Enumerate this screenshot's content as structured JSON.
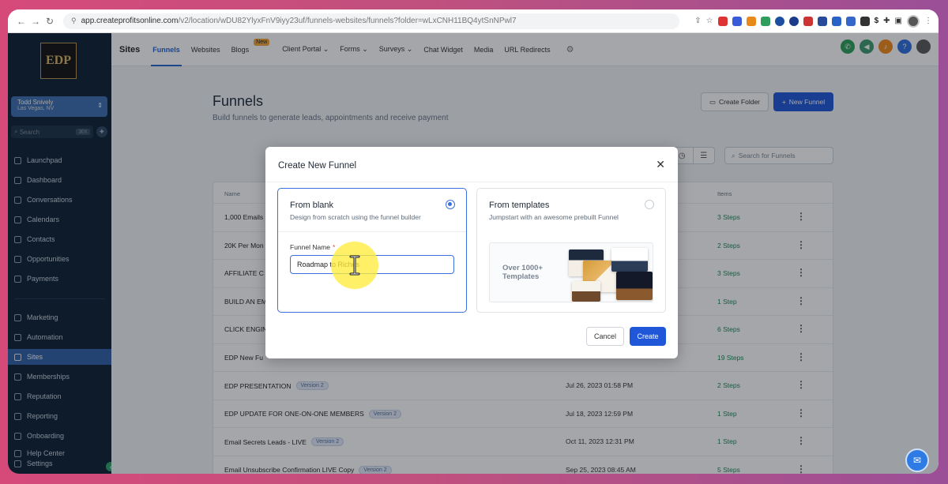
{
  "browser": {
    "url_host": "app.createprofitsonline.com",
    "url_path": "/v2/location/wDU82YlyxFnV9iyy23uf/funnels-websites/funnels?folder=wLxCNH11BQ4ytSnNPwl7"
  },
  "sidebar": {
    "logo": "EDP",
    "account_name": "Todd Snively",
    "account_location": "Las Vegas, NV",
    "search_placeholder": "Search",
    "search_shortcut": "⌘K",
    "items": [
      {
        "label": "Launchpad"
      },
      {
        "label": "Dashboard"
      },
      {
        "label": "Conversations"
      },
      {
        "label": "Calendars"
      },
      {
        "label": "Contacts"
      },
      {
        "label": "Opportunities"
      },
      {
        "label": "Payments"
      },
      {
        "label": "Marketing"
      },
      {
        "label": "Automation"
      },
      {
        "label": "Sites"
      },
      {
        "label": "Memberships"
      },
      {
        "label": "Reputation"
      },
      {
        "label": "Reporting"
      },
      {
        "label": "Onboarding"
      },
      {
        "label": "Help Center"
      },
      {
        "label": "Settings"
      }
    ]
  },
  "topnav": {
    "brand": "Sites",
    "tabs": [
      {
        "label": "Funnels"
      },
      {
        "label": "Websites"
      },
      {
        "label": "Blogs"
      },
      {
        "label": "Client Portal ⌄"
      },
      {
        "label": "Forms ⌄"
      },
      {
        "label": "Surveys ⌄"
      },
      {
        "label": "Chat Widget"
      },
      {
        "label": "Media"
      },
      {
        "label": "URL Redirects"
      }
    ],
    "new_badge": "New"
  },
  "main": {
    "title": "Funnels",
    "subtitle": "Build funnels to generate leads, appointments and receive payment",
    "create_folder": "Create Folder",
    "new_funnel": "New Funnel",
    "search_placeholder": "Search for Funnels",
    "col_name": "Name",
    "col_items": "Items",
    "rows": [
      {
        "name": "1,000 Emails",
        "version": "",
        "date": "",
        "steps": "3 Steps"
      },
      {
        "name": "20K Per Mon",
        "version": "",
        "date": "",
        "steps": "2 Steps"
      },
      {
        "name": "AFFILIATE C",
        "version": "",
        "date": "",
        "steps": "3 Steps"
      },
      {
        "name": "BUILD AN EM",
        "version": "",
        "date": "",
        "steps": "1 Step"
      },
      {
        "name": "CLICK ENGIN",
        "version": "",
        "date": "",
        "steps": "6 Steps"
      },
      {
        "name": "EDP New Fu",
        "version": "",
        "date": "",
        "steps": "19 Steps"
      },
      {
        "name": "EDP PRESENTATION",
        "version": "Version 2",
        "date": "Jul 26, 2023 01:58 PM",
        "steps": "2 Steps"
      },
      {
        "name": "EDP UPDATE FOR ONE-ON-ONE MEMBERS",
        "version": "Version 2",
        "date": "Jul 18, 2023 12:59 PM",
        "steps": "1 Step"
      },
      {
        "name": "Email Secrets Leads - LIVE",
        "version": "Version 2",
        "date": "Oct 11, 2023 12:31 PM",
        "steps": "1 Step"
      },
      {
        "name": "Email Unsubscribe Confirmation LIVE Copy",
        "version": "Version 2",
        "date": "Sep 25, 2023 08:45 AM",
        "steps": "5 Steps"
      }
    ]
  },
  "modal": {
    "title": "Create New Funnel",
    "blank_title": "From blank",
    "blank_desc": "Design from scratch using the funnel builder",
    "funnel_name_label": "Funnel Name",
    "required_mark": "*",
    "funnel_name_value": "Roadmap to Riches",
    "templates_title": "From templates",
    "templates_desc": "Jumpstart with an awesome prebuilt Funnel",
    "templates_preview_text": "Over 1000+ Templates",
    "cancel": "Cancel",
    "create": "Create"
  },
  "colors": {
    "accent": "#1f57d8",
    "sidebar_bg": "#0c2034",
    "active_nav": "#2f5fa8",
    "steps_green": "#1d8a56",
    "cursor_highlight": "#ffec3c"
  }
}
